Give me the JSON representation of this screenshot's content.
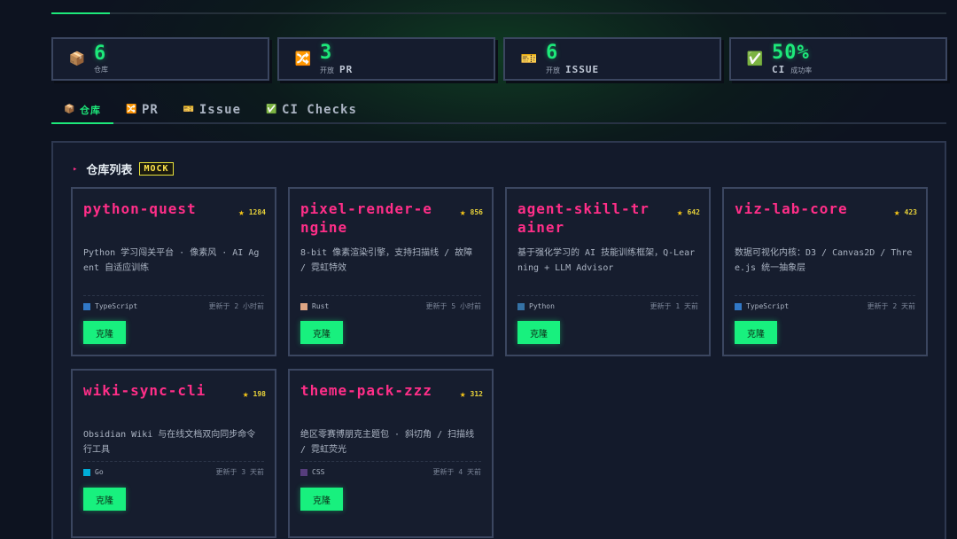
{
  "progress": {
    "value": 0.065
  },
  "stats": [
    {
      "icon": "package-icon",
      "value": "6",
      "label": "仓库",
      "label_en": "",
      "color": "#1de97a"
    },
    {
      "icon": "shuffle-icon",
      "value": "3",
      "label": "开放",
      "label_en": "PR",
      "color": "#1de97a"
    },
    {
      "icon": "ticket-icon",
      "value": "6",
      "label": "开放",
      "label_en": "ISSUE",
      "color": "#1de97a"
    },
    {
      "icon": "check-icon",
      "value": "50%",
      "label": "成功率",
      "label_en": "CI",
      "color": "#1de97a"
    }
  ],
  "tabs": [
    {
      "label": "仓库",
      "icon": "package-icon",
      "active": true
    },
    {
      "label": "PR",
      "icon": "shuffle-icon",
      "active": false
    },
    {
      "label": "Issue",
      "icon": "ticket-icon",
      "active": false
    },
    {
      "label": "CI Checks",
      "icon": "check-icon",
      "active": false
    }
  ],
  "panel": {
    "title": "仓库列表",
    "badge": "MOCK",
    "arrow": "▸"
  },
  "repos": [
    {
      "name": "python-quest",
      "stars": "1284",
      "desc": "Python 学习闯关平台 · 像素风 · AI Agent 自适应训练",
      "lang": "TypeScript",
      "lang_color": "#3178c6",
      "updated": "更新于 2 小时前",
      "clone": "克隆"
    },
    {
      "name": "pixel-render-engine",
      "stars": "856",
      "desc": "8-bit 像素渲染引擎，支持扫描线 / 故障 / 霓虹特效",
      "lang": "Rust",
      "lang_color": "#dea584",
      "updated": "更新于 5 小时前",
      "clone": "克隆"
    },
    {
      "name": "agent-skill-trainer",
      "stars": "642",
      "desc": "基于强化学习的 AI 技能训练框架，Q-Learning + LLM Advisor",
      "lang": "Python",
      "lang_color": "#3572a5",
      "updated": "更新于 1 天前",
      "clone": "克隆"
    },
    {
      "name": "viz-lab-core",
      "stars": "423",
      "desc": "数据可视化内核：D3 / Canvas2D / Three.js 统一抽象层",
      "lang": "TypeScript",
      "lang_color": "#3178c6",
      "updated": "更新于 2 天前",
      "clone": "克隆"
    },
    {
      "name": "wiki-sync-cli",
      "stars": "198",
      "desc": "Obsidian Wiki 与在线文档双向同步命令行工具",
      "lang": "Go",
      "lang_color": "#00add8",
      "updated": "更新于 3 天前",
      "clone": "克隆"
    },
    {
      "name": "theme-pack-zzz",
      "stars": "312",
      "desc": "绝区零赛博朋克主题包 · 斜切角 / 扫描线 / 霓虹荧光",
      "lang": "CSS",
      "lang_color": "#563d7c",
      "updated": "更新于 4 天前",
      "clone": "克隆"
    }
  ]
}
